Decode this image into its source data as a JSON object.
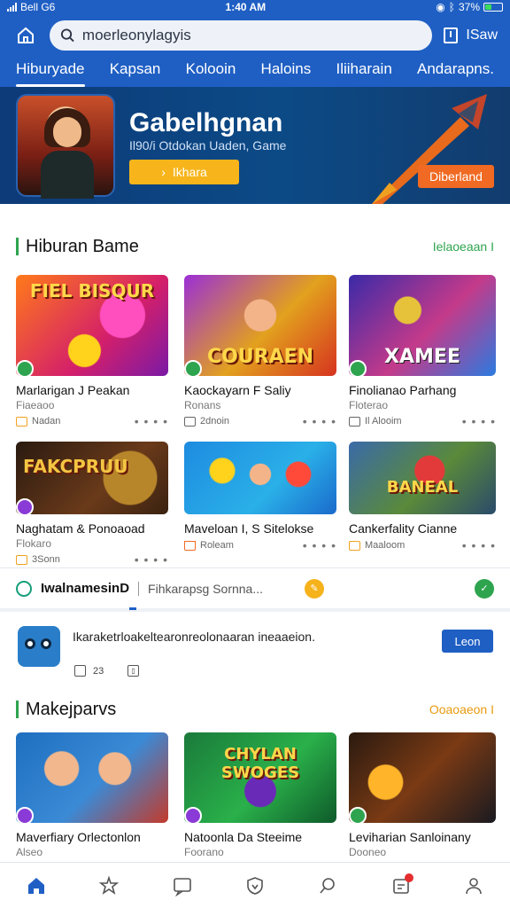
{
  "status_bar": {
    "carrier": "Bell G6",
    "time": "1:40 AM",
    "battery": "37%",
    "battery_level": 0.37
  },
  "top_bar": {
    "search_value": "moerleonylagyis",
    "save_label": "ISaw"
  },
  "category_tabs": [
    "Hiburyade",
    "Kapsan",
    "Kolooin",
    "Haloins",
    "Iliiharain",
    "Andarapns."
  ],
  "banner": {
    "title": "Gabelhgnan",
    "subtitle": "Il90/i Otdokan Uaden, Game",
    "play_label": "Ikhara",
    "download_label": "Diberland"
  },
  "section1": {
    "title": "Hiburan Bame",
    "link": "Ielaoeaan I",
    "cards": [
      {
        "thumb_text": "FIEL BISQUR",
        "title": "Marlarigan J Peakan",
        "sub": "Fiaeaoo",
        "meta": "Nadan"
      },
      {
        "thumb_text": "COURAEN",
        "title": "Kaockayarn F Saliy",
        "sub": "Ronans",
        "meta": "2dnoin"
      },
      {
        "thumb_text": "XAMEE",
        "title": "Finolianao Parhang",
        "sub": "Floterao",
        "meta": "Il Alooim"
      },
      {
        "thumb_text": "FAKCPRUU",
        "title": "Naghatam & Ponoaoad",
        "sub": "Flokaro",
        "meta": "3Sonn"
      },
      {
        "thumb_text": "",
        "title": "Maveloan I, S Sitelokse",
        "sub": "",
        "meta": "Roleam"
      },
      {
        "thumb_text": "BANEAL",
        "title": "Cankerfality Cianne",
        "sub": "",
        "meta": "Maaloom"
      }
    ]
  },
  "filter": {
    "name": "IwalnamesinD",
    "hint": "Fihkarapsg Sornna..."
  },
  "notification": {
    "text": "Ikaraketrloakeltearonreolonaaran ineaaeion.",
    "button": "Leon",
    "stat1": "23",
    "stat2": ""
  },
  "section2": {
    "title": "Makejparvs",
    "link": "Ooaoaeon I",
    "cards": [
      {
        "thumb_text": "",
        "title": "Maverfiary Orlectonlon",
        "sub": "Alseo",
        "meta": ""
      },
      {
        "thumb_text": "CHYLAN SWOGES",
        "title": "Natoonla Da Steeime",
        "sub": "Foorano",
        "meta": ""
      },
      {
        "thumb_text": "",
        "title": "Leviharian Sanloinany",
        "sub": "Dooneo",
        "meta": ""
      }
    ]
  },
  "colors": {
    "primary": "#1f5fc4",
    "accent_green": "#2ea44f",
    "accent_orange": "#f06a23",
    "accent_yellow": "#f7b51b"
  },
  "icons": [
    "home-icon",
    "star-icon",
    "chat-icon",
    "shield-icon",
    "search-icon",
    "inbox-icon",
    "profile-icon"
  ]
}
